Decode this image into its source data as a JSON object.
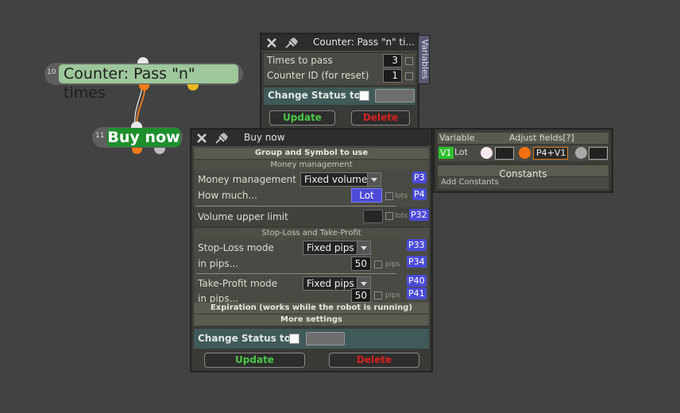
{
  "blocks": {
    "counter": {
      "number": "10",
      "title": "Counter: Pass \"n\" times"
    },
    "buy": {
      "number": "11",
      "title": "Buy now"
    }
  },
  "counter_panel": {
    "title": "Counter: Pass \"n\" ti...",
    "side_tab": "Variables",
    "fields": [
      {
        "label": "Times to pass",
        "value": "3"
      },
      {
        "label": "Counter ID (for reset)",
        "value": "1"
      }
    ],
    "change_status_label": "Change Status to",
    "update_label": "Update",
    "delete_label": "Delete"
  },
  "buy_panel": {
    "title": "Buy now",
    "section_group": "Group and Symbol to use",
    "subsection_money": "Money management",
    "money_mode_label": "Money management",
    "money_mode_value": "Fixed volume",
    "money_mode_param": "P3",
    "how_much_label": "How much...",
    "how_much_value": "Lot",
    "how_much_unit": "lots",
    "how_much_param": "P4",
    "volume_limit_label": "Volume upper limit",
    "volume_limit_unit": "lots",
    "volume_limit_param": "P32",
    "subsection_sltp": "Stop-Loss and Take-Profit",
    "sl_mode_label": "Stop-Loss mode",
    "sl_mode_value": "Fixed pips",
    "sl_mode_param": "P33",
    "sl_pips_label": "in pips...",
    "sl_pips_value": "50",
    "sl_pips_unit": "pips",
    "sl_pips_param": "P34",
    "tp_mode_label": "Take-Profit mode",
    "tp_mode_value": "Fixed pips",
    "tp_mode_param": "P40",
    "tp_pips_label": "in pips...",
    "tp_pips_value": "50",
    "tp_pips_unit": "pips",
    "tp_pips_param": "P41",
    "section_expiration": "Expiration (works while the robot is running)",
    "section_more": "More settings",
    "change_status_label": "Change Status to",
    "update_label": "Update",
    "delete_label": "Delete"
  },
  "variables_panel": {
    "col_variable": "Variable",
    "col_adjust": "Adjust fields[?]",
    "var_tag": "V1",
    "var_name": "Lot",
    "formula": "P4+V1",
    "constants_header": "Constants",
    "add_constants": "Add Constants"
  },
  "colors": {
    "canvas": "#424242",
    "counter_block": "#9ec79b",
    "buy_block": "#1f8f2e",
    "connector_orange": "#f07a1a",
    "connector_yellow": "#e8b820",
    "param_tag": "#4b4bd6",
    "update_text": "#4ac84a",
    "delete_text": "#d82020"
  }
}
